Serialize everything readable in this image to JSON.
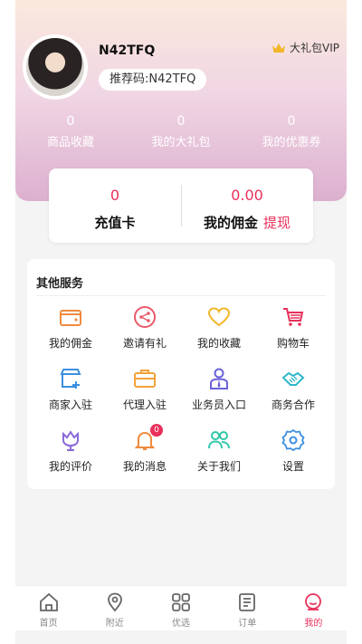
{
  "profile": {
    "username": "N42TFQ",
    "referral_code": "推荐码:N42TFQ",
    "vip_label": "大礼包VIP"
  },
  "stats": [
    {
      "value": "0",
      "label": "商品收藏"
    },
    {
      "value": "0",
      "label": "我的大礼包"
    },
    {
      "value": "0",
      "label": "我的优惠券"
    }
  ],
  "wallet": {
    "card_value": "0",
    "card_label": "充值卡",
    "commission_value": "0.00",
    "commission_label": "我的佣金",
    "withdraw_label": "提现"
  },
  "services": {
    "title": "其他服务",
    "items": [
      {
        "label": "我的佣金",
        "icon": "wallet-icon"
      },
      {
        "label": "邀请有礼",
        "icon": "share-icon"
      },
      {
        "label": "我的收藏",
        "icon": "heart-icon"
      },
      {
        "label": "购物车",
        "icon": "cart-icon"
      },
      {
        "label": "商家入驻",
        "icon": "store-icon"
      },
      {
        "label": "代理入驻",
        "icon": "briefcase-icon"
      },
      {
        "label": "业务员入口",
        "icon": "salesperson-icon"
      },
      {
        "label": "商务合作",
        "icon": "handshake-icon"
      },
      {
        "label": "我的评价",
        "icon": "flower-icon"
      },
      {
        "label": "我的消息",
        "icon": "bell-icon",
        "badge": "0"
      },
      {
        "label": "关于我们",
        "icon": "people-icon"
      },
      {
        "label": "设置",
        "icon": "gear-icon"
      }
    ]
  },
  "tabbar": {
    "items": [
      {
        "label": "首页",
        "icon": "home-icon"
      },
      {
        "label": "附近",
        "icon": "location-icon"
      },
      {
        "label": "优选",
        "icon": "grid-icon"
      },
      {
        "label": "订单",
        "icon": "order-icon"
      },
      {
        "label": "我的",
        "icon": "user-icon",
        "active": true
      }
    ]
  },
  "colors": {
    "accent": "#e8305a",
    "header_top": "#fbe9dc",
    "header_bottom": "#dcb0cf",
    "vip_crown": "#f2b62a"
  }
}
